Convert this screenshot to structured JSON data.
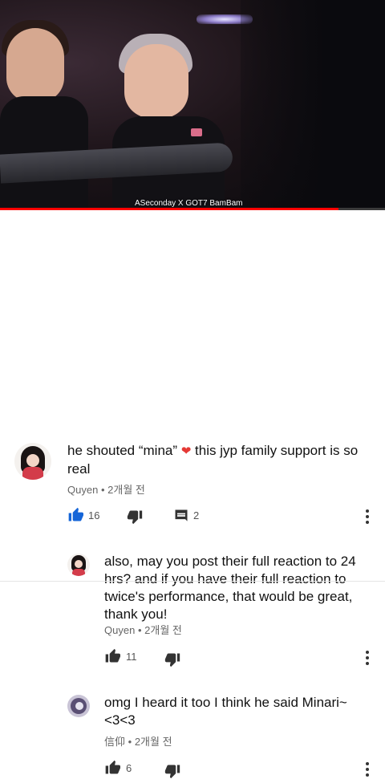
{
  "video": {
    "caption": "ASeconday X GOT7 BamBam",
    "progress_percent": 88,
    "progress_color": "#ff0000"
  },
  "comment": {
    "text_before_emoji": "he shouted “mina” ",
    "emoji": "❤",
    "text_after_emoji": " this jyp family support is so real",
    "author": "Quyen",
    "separator": "•",
    "time": "2개월 전",
    "likes": "16",
    "replies": "2",
    "avatar_icon": "girl-avatar-icon"
  },
  "replies": [
    {
      "text": "also, may you post their full reaction to 24 hrs? and if you have their full reaction to twice's performance, that would be great, thank you!",
      "author": "Quyen",
      "separator": "•",
      "time": "2개월 전",
      "likes": "11"
    },
    {
      "text": "omg I heard it too I think he said Minari~ <3<3",
      "author": "信仰",
      "separator": "•",
      "time": "2개월 전",
      "likes": "6"
    }
  ],
  "colors": {
    "like_active": "#1565d8",
    "heart": "#e53935"
  }
}
